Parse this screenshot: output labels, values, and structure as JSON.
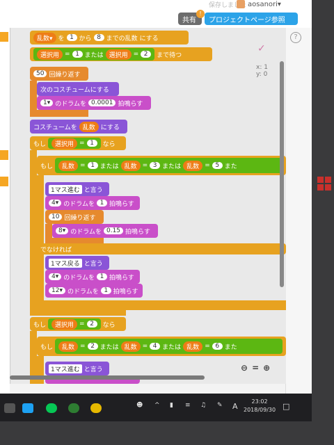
{
  "header": {
    "saved_text": "保存しました",
    "username": "aosanori▾",
    "share_button": "共有",
    "project_page_button": "プロジェクトページ参照",
    "notification": "!"
  },
  "stage": {
    "sprite_mark": "✓",
    "x_label": "x: 1",
    "y_label": "y: 0"
  },
  "help_label": "?",
  "zoom": {
    "out": "⊖",
    "reset": "=",
    "in": "⊕"
  },
  "blocks": {
    "b1": {
      "var": "乱数▾",
      "t1": "を",
      "n1": "1",
      "t2": "から",
      "n2": "8",
      "t3": "までの乱数",
      "t4": "にする"
    },
    "b2": {
      "var1": "選択用",
      "eq": "=",
      "n1": "1",
      "or": "または",
      "var2": "選択用",
      "n2": "2",
      "tail": "まで待つ"
    },
    "b3": {
      "n": "50",
      "label": "回繰り返す"
    },
    "b4": {
      "label": "次のコスチュームにする"
    },
    "b5": {
      "drum": "1▾",
      "t1": "のドラムを",
      "n": "0.0001",
      "t2": "拍鳴らす"
    },
    "b6": {
      "t1": "コスチュームを",
      "var": "乱数",
      "t2": "にする"
    },
    "b7": {
      "if": "もし",
      "var": "選択用",
      "eq": "=",
      "n": "1",
      "then": "なら"
    },
    "b8": {
      "if": "もし",
      "v1": "乱数",
      "n1": "1",
      "or1": "または",
      "v2": "乱数",
      "n2": "3",
      "or2": "または",
      "v3": "乱数",
      "n3": "5",
      "or3": "また"
    },
    "b9": {
      "say": "1マス進む",
      "t": "と言う"
    },
    "b10": {
      "drum": "4▾",
      "t1": "のドラムを",
      "n": "1",
      "t2": "拍鳴らす"
    },
    "b11": {
      "n": "10",
      "label": "回繰り返す"
    },
    "b12": {
      "drum": "8▾",
      "t1": "のドラムを",
      "n": "0.15",
      "t2": "拍鳴らす"
    },
    "b13": {
      "label": "でなければ"
    },
    "b14": {
      "say": "1マス戻る",
      "t": "と言う"
    },
    "b15": {
      "drum": "4▾",
      "t1": "のドラムを",
      "n": "1",
      "t2": "拍鳴らす"
    },
    "b16": {
      "drum": "12▾",
      "t1": "のドラムを",
      "n": "1",
      "t2": "拍鳴らす"
    },
    "b17": {
      "if": "もし",
      "var": "選択用",
      "eq": "=",
      "n": "2",
      "then": "なら"
    },
    "b18": {
      "if": "もし",
      "v1": "乱数",
      "n1": "2",
      "or1": "または",
      "v2": "乱数",
      "n2": "4",
      "or2": "または",
      "v3": "乱数",
      "n3": "6",
      "or3": "また"
    },
    "b19": {
      "say": "1マス進む",
      "t": "と言う"
    }
  },
  "taskbar": {
    "time": "23:02",
    "date": "2018/09/30",
    "ime": "A"
  },
  "colors": {
    "control": "#e7a220",
    "operator": "#5cb712",
    "looks": "#8a55d7",
    "sound": "#c94fc9",
    "variable": "#ee7d16"
  }
}
